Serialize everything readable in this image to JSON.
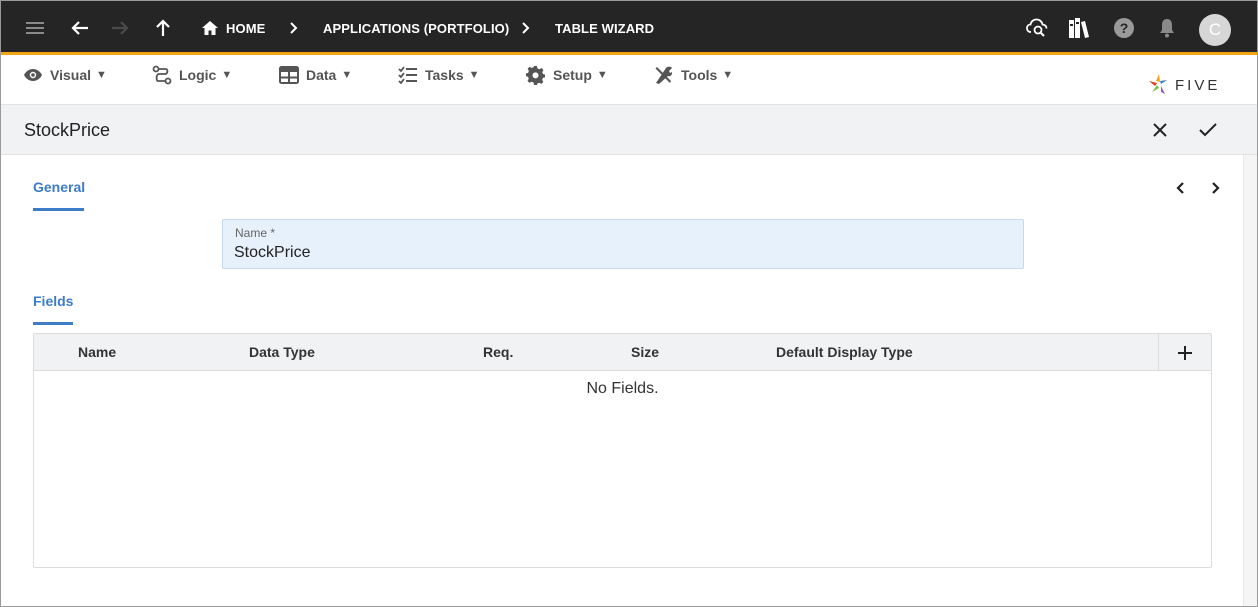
{
  "topbar": {
    "breadcrumbs": [
      {
        "label": "HOME",
        "icon": "home-icon"
      },
      {
        "label": "APPLICATIONS (PORTFOLIO)"
      },
      {
        "label": "TABLE WIZARD"
      }
    ],
    "avatar_initial": "C",
    "accent_color": "#f3a513",
    "icons": [
      "menu-icon",
      "back-arrow-icon",
      "forward-arrow-icon",
      "up-arrow-icon",
      "cloud-search-icon",
      "library-books-icon",
      "help-icon",
      "bell-icon"
    ]
  },
  "menubar": {
    "items": [
      {
        "label": "Visual",
        "icon": "eye-icon"
      },
      {
        "label": "Logic",
        "icon": "logic-flow-icon"
      },
      {
        "label": "Data",
        "icon": "table-grid-icon"
      },
      {
        "label": "Tasks",
        "icon": "checklist-icon"
      },
      {
        "label": "Setup",
        "icon": "gear-icon"
      },
      {
        "label": "Tools",
        "icon": "wrench-screwdriver-icon"
      }
    ],
    "caret": "▼",
    "logo_text": "FIVE"
  },
  "form": {
    "title": "StockPrice",
    "general_label": "General",
    "name_label": "Name *",
    "name_value": "StockPrice",
    "fields_label": "Fields",
    "columns": [
      "Name",
      "Data Type",
      "Req.",
      "Size",
      "Default Display Type"
    ],
    "empty_text": "No Fields.",
    "link_color": "#3d7cc9"
  }
}
